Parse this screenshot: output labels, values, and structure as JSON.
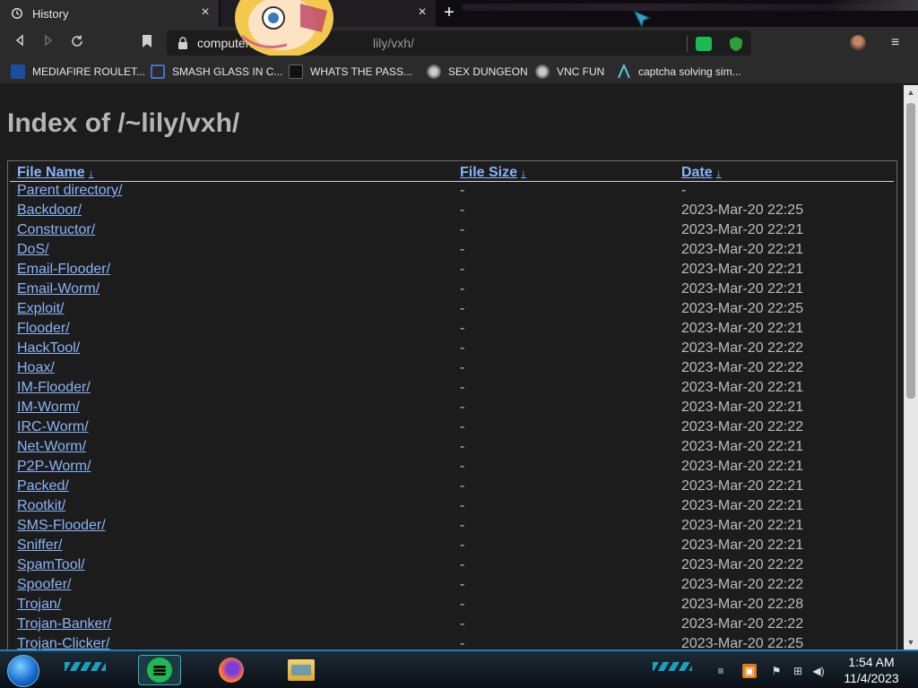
{
  "tabs": [
    {
      "title": "History",
      "icon": "history-icon"
    },
    {
      "title": "",
      "icon": "site-icon"
    }
  ],
  "navbar": {
    "url_host": "computernew",
    "url_path": "lily/vxh/"
  },
  "bookmarks": [
    {
      "label": "MEDIAFIRE ROULET...",
      "icon": "mediafire-icon"
    },
    {
      "label": "SMASH GLASS IN C...",
      "icon": "bookmark-site-icon"
    },
    {
      "label": "WHATS THE PASS...",
      "icon": "bookmark-site-icon"
    },
    {
      "label": "SEX DUNGEON",
      "icon": "bookmark-site-icon"
    },
    {
      "label": "VNC FUN",
      "icon": "bookmark-site-icon"
    },
    {
      "label": "captcha solving sim...",
      "icon": "bookmark-site-icon"
    }
  ],
  "page": {
    "title": "Index of /~lily/vxh/",
    "headers": {
      "name": "File Name",
      "size": "File Size",
      "date": "Date",
      "sort_arrow": "↓"
    },
    "rows": [
      {
        "name": "Parent directory/",
        "size": "-",
        "date": "-"
      },
      {
        "name": "Backdoor/",
        "size": "-",
        "date": "2023-Mar-20 22:25"
      },
      {
        "name": "Constructor/",
        "size": "-",
        "date": "2023-Mar-20 22:21"
      },
      {
        "name": "DoS/",
        "size": "-",
        "date": "2023-Mar-20 22:21"
      },
      {
        "name": "Email-Flooder/",
        "size": "-",
        "date": "2023-Mar-20 22:21"
      },
      {
        "name": "Email-Worm/",
        "size": "-",
        "date": "2023-Mar-20 22:21"
      },
      {
        "name": "Exploit/",
        "size": "-",
        "date": "2023-Mar-20 22:25"
      },
      {
        "name": "Flooder/",
        "size": "-",
        "date": "2023-Mar-20 22:21"
      },
      {
        "name": "HackTool/",
        "size": "-",
        "date": "2023-Mar-20 22:22"
      },
      {
        "name": "Hoax/",
        "size": "-",
        "date": "2023-Mar-20 22:22"
      },
      {
        "name": "IM-Flooder/",
        "size": "-",
        "date": "2023-Mar-20 22:21"
      },
      {
        "name": "IM-Worm/",
        "size": "-",
        "date": "2023-Mar-20 22:21"
      },
      {
        "name": "IRC-Worm/",
        "size": "-",
        "date": "2023-Mar-20 22:22"
      },
      {
        "name": "Net-Worm/",
        "size": "-",
        "date": "2023-Mar-20 22:21"
      },
      {
        "name": "P2P-Worm/",
        "size": "-",
        "date": "2023-Mar-20 22:21"
      },
      {
        "name": "Packed/",
        "size": "-",
        "date": "2023-Mar-20 22:21"
      },
      {
        "name": "Rootkit/",
        "size": "-",
        "date": "2023-Mar-20 22:21"
      },
      {
        "name": "SMS-Flooder/",
        "size": "-",
        "date": "2023-Mar-20 22:21"
      },
      {
        "name": "Sniffer/",
        "size": "-",
        "date": "2023-Mar-20 22:21"
      },
      {
        "name": "SpamTool/",
        "size": "-",
        "date": "2023-Mar-20 22:22"
      },
      {
        "name": "Spoofer/",
        "size": "-",
        "date": "2023-Mar-20 22:22"
      },
      {
        "name": "Trojan/",
        "size": "-",
        "date": "2023-Mar-20 22:28"
      },
      {
        "name": "Trojan-Banker/",
        "size": "-",
        "date": "2023-Mar-20 22:22"
      },
      {
        "name": "Trojan-Clicker/",
        "size": "-",
        "date": "2023-Mar-20 22:25"
      }
    ]
  },
  "taskbar": {
    "apps": [
      {
        "name": "Spotify",
        "icon": "spotify-icon",
        "active": true
      },
      {
        "name": "Firefox",
        "icon": "firefox-icon",
        "active": false
      },
      {
        "name": "File Explorer",
        "icon": "folder-icon",
        "active": false
      }
    ],
    "clock": {
      "time": "1:54 AM",
      "date": "11/4/2023"
    }
  },
  "colors": {
    "link": "#8ab4f8",
    "page_bg": "#1c1c1c",
    "chrome_bg": "#2b2b2b",
    "taskbar_accent": "#1e7fb0"
  }
}
